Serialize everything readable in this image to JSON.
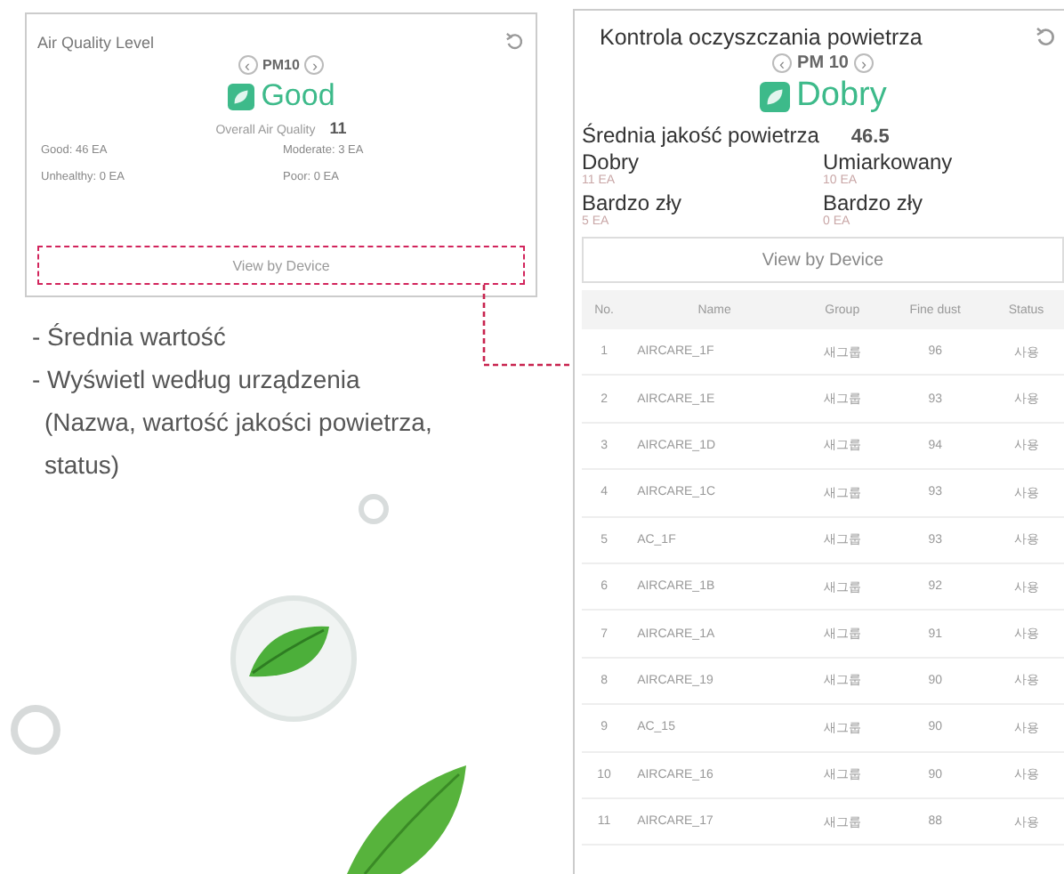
{
  "air_quality_card": {
    "title": "Air Quality Level",
    "pm_selector": {
      "prev": "‹",
      "label": "PM10",
      "next": "›"
    },
    "status": "Good",
    "overall_label": "Overall Air Quality",
    "overall_value": "11",
    "counts": [
      "Good: 46 EA",
      "Moderate: 3 EA",
      "Unhealthy: 0 EA",
      "Poor: 0 EA"
    ],
    "button": "View by Device"
  },
  "notes": [
    "- Średnia wartość",
    "- Wyświetl według urządzenia",
    "(Nazwa, wartość jakości powietrza,",
    "status)"
  ],
  "purification_card": {
    "title": "Kontrola oczyszczania powietrza",
    "pm_selector": {
      "prev": "‹",
      "label": "PM 10",
      "next": "›"
    },
    "status": "Dobry",
    "average_label": "Średnia jakość powietrza",
    "average_value": "46.5",
    "counts": [
      {
        "label": "Dobry",
        "value": "11 EA"
      },
      {
        "label": "Umiarkowany",
        "value": "10 EA"
      },
      {
        "label": "Bardzo zły",
        "value": "5 EA"
      },
      {
        "label": "Bardzo zły",
        "value": "0 EA"
      }
    ],
    "button": "View by Device",
    "table": {
      "columns": [
        "No.",
        "Name",
        "Group",
        "Fine dust",
        "Status"
      ],
      "rows": [
        [
          "1",
          "AIRCARE_1F",
          "새그룹",
          "96",
          "사용"
        ],
        [
          "2",
          "AIRCARE_1E",
          "새그룹",
          "93",
          "사용"
        ],
        [
          "3",
          "AIRCARE_1D",
          "새그룹",
          "94",
          "사용"
        ],
        [
          "4",
          "AIRCARE_1C",
          "새그룹",
          "93",
          "사용"
        ],
        [
          "5",
          "AC_1F",
          "새그룹",
          "93",
          "사용"
        ],
        [
          "6",
          "AIRCARE_1B",
          "새그룹",
          "92",
          "사용"
        ],
        [
          "7",
          "AIRCARE_1A",
          "새그룹",
          "91",
          "사용"
        ],
        [
          "8",
          "AIRCARE_19",
          "새그룹",
          "90",
          "사용"
        ],
        [
          "9",
          "AC_15",
          "새그룹",
          "90",
          "사용"
        ],
        [
          "10",
          "AIRCARE_16",
          "새그룹",
          "90",
          "사용"
        ],
        [
          "11",
          "AIRCARE_17",
          "새그룹",
          "88",
          "사용"
        ]
      ]
    }
  }
}
